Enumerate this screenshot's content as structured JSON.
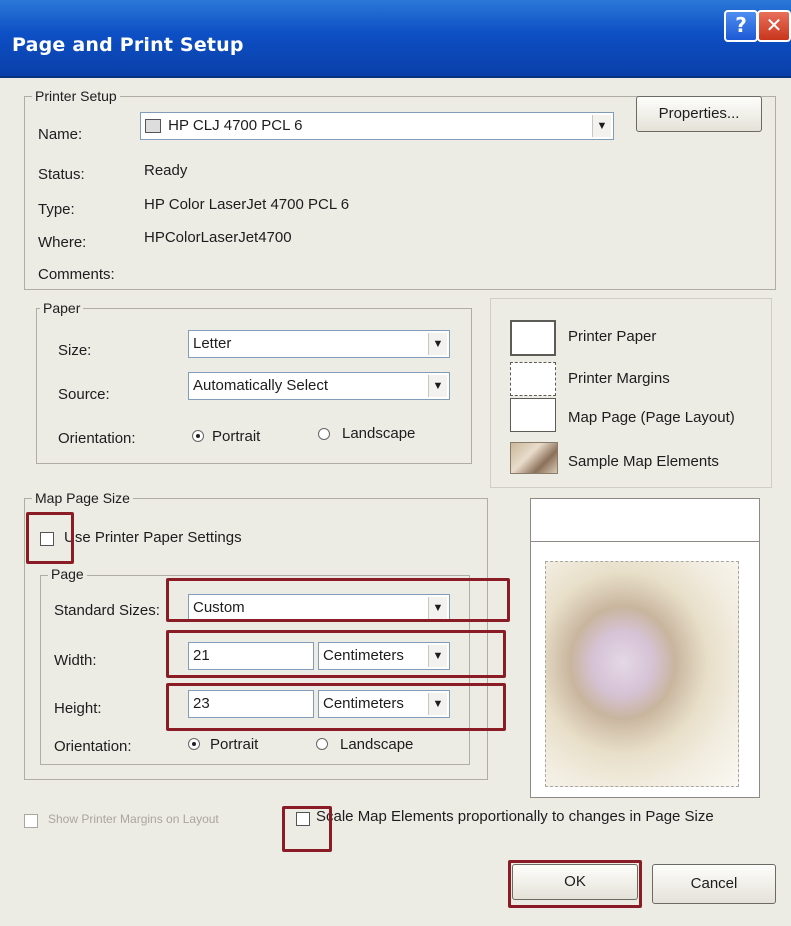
{
  "window": {
    "title": "Page and Print Setup",
    "help_glyph": "?",
    "close_glyph": "✕"
  },
  "printer_setup": {
    "legend": "Printer Setup",
    "name_label": "Name:",
    "name_value": "HP CLJ 4700 PCL 6",
    "properties_button": "Properties...",
    "status_label": "Status:",
    "status_value": "Ready",
    "type_label": "Type:",
    "type_value": "HP Color LaserJet 4700 PCL 6",
    "where_label": "Where:",
    "where_value": "HPColorLaserJet4700",
    "comments_label": "Comments:",
    "comments_value": ""
  },
  "paper": {
    "legend": "Paper",
    "size_label": "Size:",
    "size_value": "Letter",
    "source_label": "Source:",
    "source_value": "Automatically Select",
    "orientation_label": "Orientation:",
    "portrait_label": "Portrait",
    "landscape_label": "Landscape",
    "orientation_selected": "Portrait"
  },
  "legend_panel": {
    "printer_paper": "Printer Paper",
    "printer_margins": "Printer Margins",
    "map_page": "Map Page (Page Layout)",
    "sample_map": "Sample Map Elements"
  },
  "map_page_size": {
    "legend": "Map Page Size",
    "use_printer_paper": "Use Printer Paper Settings",
    "use_printer_paper_checked": false,
    "page_legend": "Page",
    "standard_sizes_label": "Standard Sizes:",
    "standard_sizes_value": "Custom",
    "width_label": "Width:",
    "width_value": "21",
    "width_units": "Centimeters",
    "height_label": "Height:",
    "height_value": "23",
    "height_units": "Centimeters",
    "orientation_label": "Orientation:",
    "portrait_label": "Portrait",
    "landscape_label": "Landscape",
    "orientation_selected": "Portrait"
  },
  "footer": {
    "show_margins_label": "Show Printer Margins on Layout",
    "show_margins_checked": false,
    "scale_label": "Scale Map Elements proportionally to changes in Page Size",
    "scale_checked": false,
    "ok_button": "OK",
    "cancel_button": "Cancel"
  },
  "colors": {
    "title_bar": "#0d4fc4",
    "highlight_border": "#8a1c26",
    "dialog_bg": "#ecebe4"
  },
  "icons": {
    "printer": "printer-icon",
    "dropdown": "chevron-down-icon",
    "sample_map": "map-thumbnail-icon"
  }
}
